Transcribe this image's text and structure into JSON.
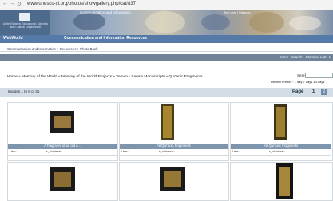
{
  "browser": {
    "url": "www.unesco-ci.org/photos/showgallery.php/cat/837"
  },
  "banner": {
    "logo_text": "United Nations Educational, Scientific and Cultural Organization",
    "title": "Communication and Information",
    "text_links": "Text only | Sitemap"
  },
  "sector_nav": {
    "webworld": "WebWorld",
    "ci_resources": "Communication and Information Resources"
  },
  "crumb_top": "Communication and Information > Resources > Photo Bank",
  "toolbar": {
    "home": "Home",
    "search": "Search",
    "member_list": "Member List",
    "last": "L"
  },
  "breadcrumb": "Home » Memory of the World » Memory of the World Projects » Yemen - Sana'a Manuscripts » Qur'anic Fragments",
  "search": {
    "label": "Search",
    "value": ""
  },
  "recent_photos": "Recent Photos : 1 day 7 days 14 days",
  "results": {
    "count_text": "Images 1 to 8 of 35",
    "page_label": "Page",
    "page_current": "1",
    "page_next": "2"
  },
  "images": [
    {
      "caption": "A Fragment of an old o...",
      "user_label": "User:",
      "user": "s_chariseau"
    },
    {
      "caption": "All Qur'anic Fragments",
      "user_label": "User:",
      "user": "s_chariseau"
    },
    {
      "caption": "All Qur'anic Fragments",
      "user_label": "User:",
      "user": "s_chariseau"
    },
    {
      "caption": "",
      "user_label": "",
      "user": ""
    },
    {
      "caption": "",
      "user_label": "",
      "user": ""
    },
    {
      "caption": "",
      "user_label": "",
      "user": ""
    }
  ]
}
